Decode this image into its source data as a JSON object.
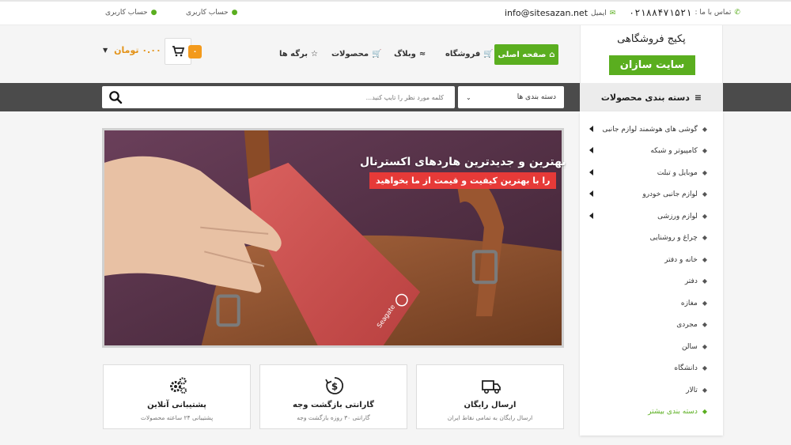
{
  "topbar": {
    "contact_label": "تماس با ما :",
    "phone": "۰۲۱۸۸۴۷۱۵۲۱",
    "email_label": "ایمیل",
    "email": "info@sitesazan.net",
    "account_1": "حساب کاربری",
    "account_2": "حساب کاربری"
  },
  "logo": {
    "title": "پکیج فروشگاهی",
    "badge": "سایت سازان"
  },
  "nav": {
    "items": [
      {
        "label": "صفحه اصلی",
        "icon": "home-icon"
      },
      {
        "label": "فروشگاه",
        "icon": "cart-icon"
      },
      {
        "label": "وبلاگ",
        "icon": "rss-icon"
      },
      {
        "label": "محصولات",
        "icon": "cart-icon"
      },
      {
        "label": "برگه ها",
        "icon": "star-icon"
      }
    ]
  },
  "cart": {
    "count": "۰",
    "price": "۰.۰۰ تومان"
  },
  "search": {
    "placeholder": "کلمه مورد نظر را تایپ کنید...",
    "category_select": "دسته بندی ها"
  },
  "sidebar": {
    "header": "دسته بندی محصولات",
    "items": [
      {
        "label": "گوشی های هوشمند لوازم جانبی",
        "has_sub": true
      },
      {
        "label": "کامپیوتر و شبکه",
        "has_sub": true
      },
      {
        "label": "موبایل و تبلت",
        "has_sub": true
      },
      {
        "label": "لوازم جانبی خودرو",
        "has_sub": true
      },
      {
        "label": "لوازم ورزشی",
        "has_sub": true
      },
      {
        "label": "چراغ و روشنایی",
        "has_sub": false
      },
      {
        "label": "خانه و دفتر",
        "has_sub": false
      },
      {
        "label": "دفتر",
        "has_sub": false
      },
      {
        "label": "مغازه",
        "has_sub": false
      },
      {
        "label": "مجردی",
        "has_sub": false
      },
      {
        "label": "سالن",
        "has_sub": false
      },
      {
        "label": "دانشگاه",
        "has_sub": false
      },
      {
        "label": "تالار",
        "has_sub": false
      },
      {
        "label": "دسته بندی بیشتر",
        "has_sub": false
      }
    ]
  },
  "slider": {
    "headline": "بهترین و جدیدترین هاردهای اکسترنال",
    "subline": "را با بهترین کیفیت و قیمت از ما بخواهید",
    "product_brand": "Seagate"
  },
  "features": [
    {
      "title": "ارسال رایگان",
      "sub": "ارسال رایگان به تمامی نقاط ایران",
      "icon": "truck-icon"
    },
    {
      "title": "گارانتی بازگشت وجه",
      "sub": "گارانتی ۳۰ روزه بازگشت وجه",
      "icon": "money-back-icon"
    },
    {
      "title": "پشتیبانی آنلاین",
      "sub": "پشتیبانی ۲۴ ساعته محصولات",
      "icon": "gears-icon"
    }
  ],
  "colors": {
    "accent": "#5aae1f",
    "orange": "#f39a1c",
    "red_banner": "#e63a38",
    "dark_bar": "#4b4b4b"
  }
}
